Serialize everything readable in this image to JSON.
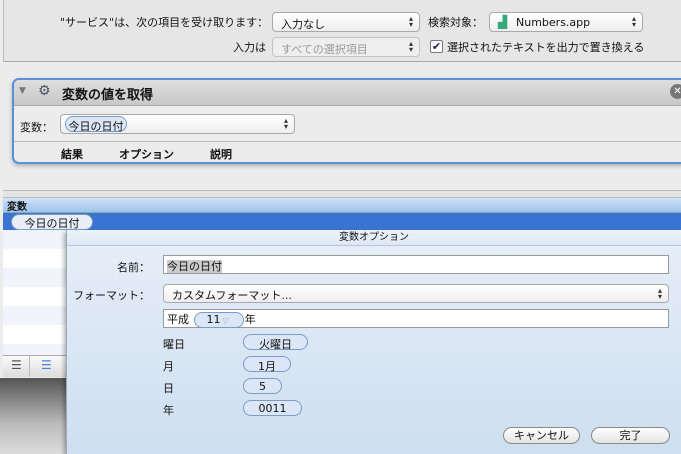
{
  "service_bar": {
    "receives_label": "\"サービス\"は、次の項目を受け取ります：",
    "input_value": "入力なし",
    "search_label": "検索対象：",
    "app_value": "Numbers.app",
    "input_is_label": "入力は",
    "input_is_value": "すべての選択項目",
    "replace_checked": true,
    "replace_label": "選択されたテキストを出力で置き換える"
  },
  "action": {
    "title": "変数の値を取得",
    "variable_label": "変数：",
    "variable_value": "今日の日付",
    "tabs": [
      "結果",
      "オプション",
      "説明"
    ]
  },
  "variables_pane": {
    "header": "変数",
    "selected_item": "今日の日付"
  },
  "sheet": {
    "title": "変数オプション",
    "name_label": "名前：",
    "name_value": "今日の日付",
    "format_label": "フォーマット：",
    "format_value": "カスタムフォーマット...",
    "format_tokens": {
      "era": "平成",
      "year": "11",
      "suffix": "年"
    },
    "components": [
      {
        "label": "曜日",
        "token": "火曜日"
      },
      {
        "label": "月",
        "token": "1月"
      },
      {
        "label": "日",
        "token": "5"
      },
      {
        "label": "年",
        "token": "0011"
      }
    ],
    "cancel": "キャンセル",
    "done": "完了"
  }
}
